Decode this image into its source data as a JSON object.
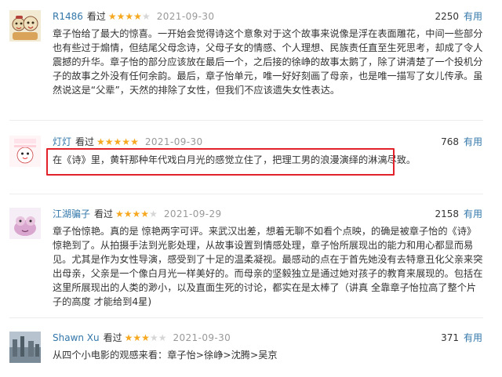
{
  "reviews": [
    {
      "author": "R1486",
      "verb": "看过",
      "rating": 4,
      "date": "2021-09-30",
      "votes": "2250",
      "useful_label": "有用",
      "content": "章子怡给了最大的惊喜。一开始会觉得诗这个意象对于这个故事来说像是浮在表面雕花，中间一些部分也有些过于煽情，但结尾父母念诗，父母子女的情感、个人理想、民族责任直至生死思考，却成了令人震撼的升华。章子怡的部分应该放在最后一个，之后接的徐峥的故事太鹅了，除了讲清楚了一个投机分子的故事之外没有任何余韵。最后，章子怡单元，唯一好好刻画了母亲，也是唯一描写了女儿传承。虽然说这是“父辈”，天然的排除了女性，但我们不应该遗失女性表达。"
    },
    {
      "author": "灯灯",
      "verb": "看过",
      "rating": 5,
      "date": "2021-09-30",
      "votes": "768",
      "useful_label": "有用",
      "avatar_text": "我心若 我爱你 我心一 知错喜爱你",
      "content": "在《诗》里，黄轩那种年代戏白月光的感觉立住了，把理工男的浪漫演绎的淋漓尽致。"
    },
    {
      "author": "江湖骗子",
      "verb": "看过",
      "rating": 4,
      "date": "2021-09-29",
      "votes": "2158",
      "useful_label": "有用",
      "content": "章子怡惊艳。真的是 惊艳两字可评。来武汉出差，想着无聊不如看个点映，的确是被章子怡的《诗》惊艳到了。从拍摄手法到光影处理，从故事设置到情感处理，章子怡所展现出的能力和用心都显而易见。尤其是作为女性导演，感受到了十足的温柔凝视。最感动的点在于首先她没有去特意丑化父亲来突出母亲，父亲是一个像白月光一样美好的。而母亲的坚毅独立是通过她对孩子的教育来展现的。包括在这里所展现出的人类的渺小，以及直面生死的讨论，都实在是太棒了（讲真 全靠章子怡拉高了整个片子的高度 才能给到4星)"
    },
    {
      "author": "Shawn Xu",
      "verb": "看过",
      "rating": 3,
      "date": "2021-09-30",
      "votes": "371",
      "useful_label": "有用",
      "content": "从四个小电影的观感来看：章子怡>徐峥>沈腾>吴京"
    }
  ],
  "colors": {
    "link": "#3377aa",
    "star": "#f6a920",
    "star_off": "#d6d6d6",
    "highlight_border": "#e2222a"
  }
}
